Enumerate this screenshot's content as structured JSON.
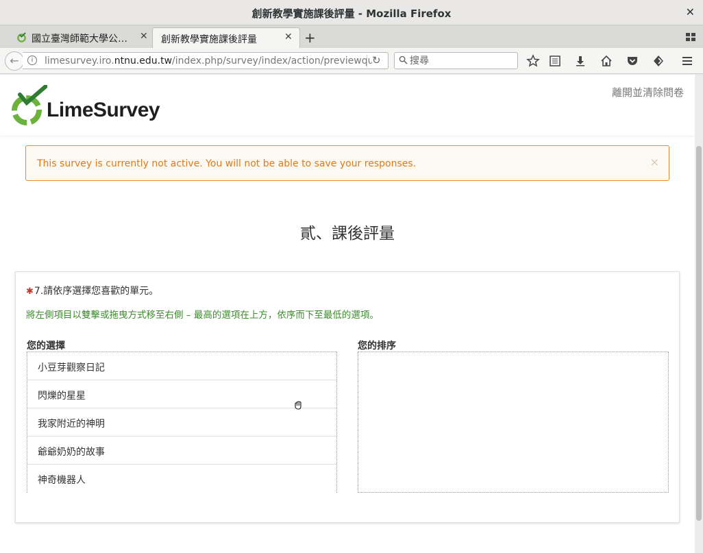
{
  "window": {
    "title": "創新教學實施課後評量 - Mozilla Firefox",
    "close_glyph": "✕"
  },
  "tabs": [
    {
      "label": "國立臺灣師範大學公…",
      "close_glyph": "✕"
    },
    {
      "label": "創新教學實施課後評量",
      "close_glyph": "✕"
    }
  ],
  "toolbar": {
    "new_tab_glyph": "+",
    "back_glyph": "←",
    "reload_glyph": "↻"
  },
  "address": {
    "prefix": "limesurvey.iro.",
    "domain": "ntnu.edu.tw",
    "path": "/index.php/survey/index/action/previewque"
  },
  "search": {
    "placeholder": "搜尋"
  },
  "header": {
    "brand": "LimeSurvey",
    "exit_link": "離開並清除問卷"
  },
  "alert": {
    "message": "This survey is currently not active. You will not be able to save your responses.",
    "dismiss": "×"
  },
  "group": {
    "title": "貳、課後評量"
  },
  "question": {
    "mandatory_mark": "✱",
    "text": "7.請依序選擇您喜歡的單元。",
    "help": "將左側項目以雙擊或拖曳方式移至右側 – 最高的選項在上方，依序而下至最低的選項。",
    "choices_header": "您的選擇",
    "ranking_header": "您的排序",
    "choices": [
      "小豆芽觀察日記",
      "閃爍的星星",
      "我家附近的神明",
      "爺爺奶奶的故事",
      "神奇機器人"
    ]
  },
  "colors": {
    "alert_border": "#e9882e",
    "alert_text": "#e17a1a",
    "help_text": "#3c8b2c",
    "logo_green": "#6cb33e"
  }
}
